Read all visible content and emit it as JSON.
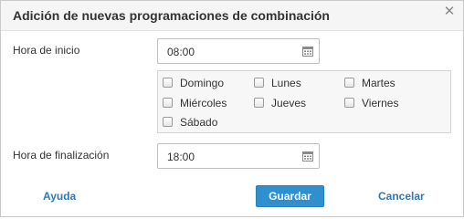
{
  "dialog": {
    "title": "Adición de nuevas programaciones de combinación",
    "close_icon": "close-icon"
  },
  "form": {
    "start_label": "Hora de inicio",
    "start_value": "08:00",
    "end_label": "Hora de finalización",
    "end_value": "18:00",
    "calendar_icon": "calendar-icon"
  },
  "days": [
    {
      "label": "Domingo",
      "checked": false
    },
    {
      "label": "Lunes",
      "checked": false
    },
    {
      "label": "Martes",
      "checked": false
    },
    {
      "label": "Miércoles",
      "checked": false
    },
    {
      "label": "Jueves",
      "checked": false
    },
    {
      "label": "Viernes",
      "checked": false
    },
    {
      "label": "Sábado",
      "checked": false
    }
  ],
  "footer": {
    "help_label": "Ayuda",
    "save_label": "Guardar",
    "cancel_label": "Cancelar"
  },
  "colors": {
    "accent": "#2f8fcf",
    "link": "#2a7ab8"
  }
}
